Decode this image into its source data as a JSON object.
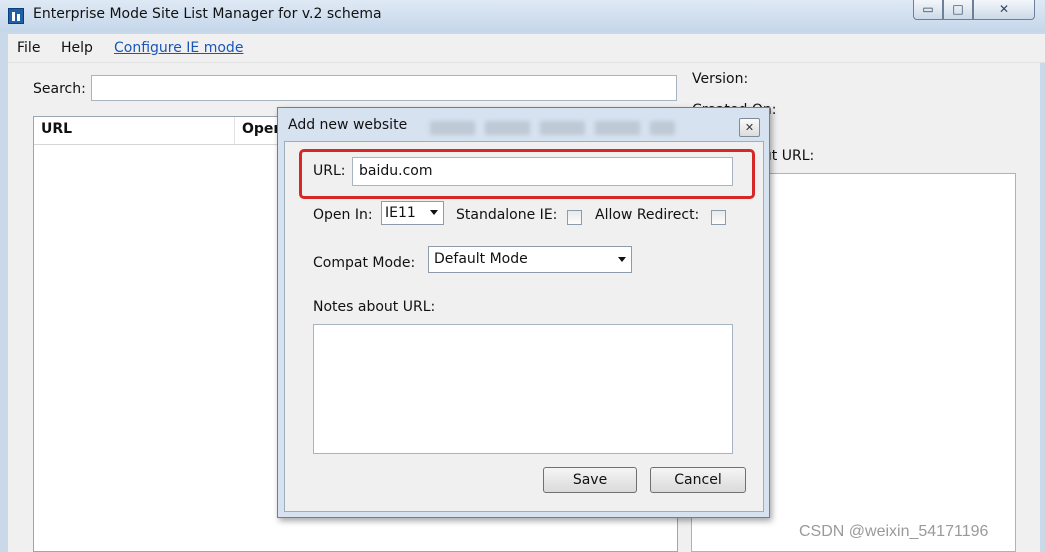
{
  "window": {
    "title": "Enterprise Mode Site List Manager for v.2 schema",
    "min_glyph": "▭",
    "max_glyph": "□",
    "close_glyph": "✕"
  },
  "menu": {
    "file": "File",
    "help": "Help",
    "configure": "Configure IE mode"
  },
  "main": {
    "search_label": "Search:",
    "search_value": "",
    "version_label": "Version:",
    "created_label": "Created On:",
    "notes_label": "Notes about URL:",
    "columns": [
      "URL",
      "Open In"
    ]
  },
  "dialog": {
    "title": "Add new website",
    "close_glyph": "✕",
    "url_label": "URL:",
    "url_value": "baidu.com",
    "open_in_label": "Open In:",
    "open_in_value": "IE11",
    "standalone_label": "Standalone IE:",
    "allow_redirect_label": "Allow Redirect:",
    "compat_label": "Compat Mode:",
    "compat_value": "Default Mode",
    "notes_label": "Notes about URL:",
    "save": "Save",
    "cancel": "Cancel"
  },
  "watermark": "CSDN @weixin_54171196",
  "colors": {
    "highlight": "#d62828",
    "link": "#1a55b8",
    "titlebar": "#c5d6ea"
  },
  "icons": [
    "app-icon",
    "minimize-icon",
    "maximize-icon",
    "close-icon",
    "dropdown-arrow-icon"
  ]
}
